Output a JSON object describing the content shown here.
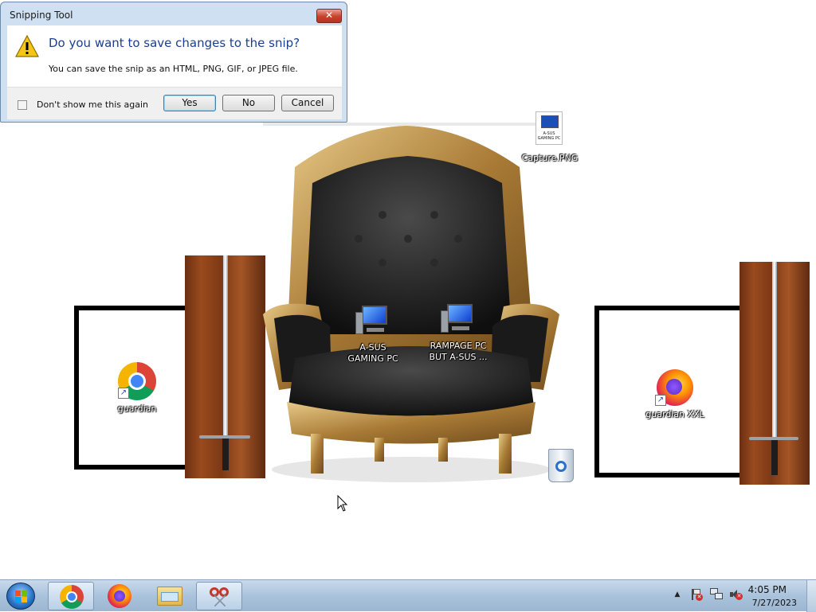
{
  "dialog": {
    "title": "Snipping Tool",
    "close_label": "✕",
    "question": "Do you want to save changes to the snip?",
    "message": "You can save the snip as an HTML, PNG, GIF, or JPEG file.",
    "checkbox_label": "Don't show me this again",
    "yes_label": "Yes",
    "no_label": "No",
    "cancel_label": "Cancel",
    "icon": "warning-icon"
  },
  "desktop": {
    "icons": [
      {
        "name": "Capture.PNG",
        "thumb_text": "A-SUS GAMING PC",
        "icon": "image-file-icon"
      },
      {
        "name_line1": "A-SUS",
        "name_line2": "GAMING PC",
        "icon": "computer-icon"
      },
      {
        "name_line1": "RAMPAGE PC",
        "name_line2": "BUT A-SUS ...",
        "icon": "computer-icon"
      },
      {
        "name": "guardian",
        "icon": "chrome-icon"
      },
      {
        "name": "guardian XXL",
        "icon": "firefox-icon"
      },
      {
        "name": "",
        "icon": "recycle-bin-icon"
      }
    ]
  },
  "taskbar": {
    "pinned": [
      {
        "name": "start",
        "icon": "windows-logo-icon"
      },
      {
        "name": "chrome",
        "icon": "chrome-icon"
      },
      {
        "name": "firefox",
        "icon": "firefox-icon"
      },
      {
        "name": "explorer",
        "icon": "folder-icon"
      },
      {
        "name": "snipping-tool",
        "icon": "scissors-icon"
      }
    ],
    "tray_icons": [
      "show-hidden-icon",
      "action-center-icon",
      "network-icon",
      "volume-muted-icon"
    ],
    "time": "4:05 PM",
    "date": "7/27/2023"
  }
}
